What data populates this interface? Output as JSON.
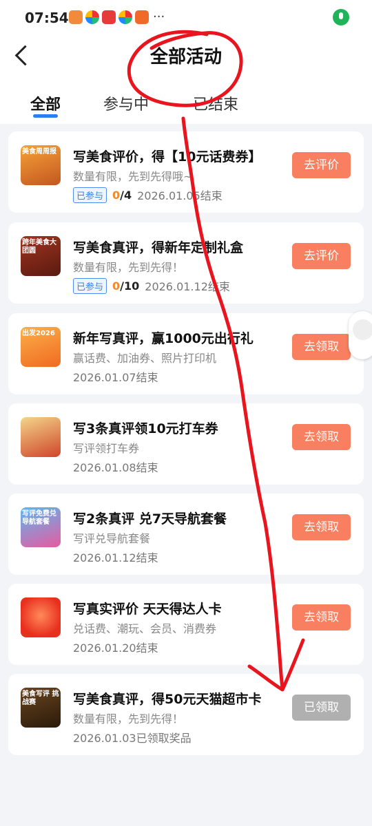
{
  "status_bar": {
    "time": "07:54",
    "dots": "···"
  },
  "header": {
    "title": "全部活动",
    "tabs": [
      {
        "label": "全部",
        "active": true
      },
      {
        "label": "参与中",
        "active": false
      },
      {
        "label": "已结束",
        "active": false
      }
    ]
  },
  "cards": [
    {
      "thumb_label": "美食周周报",
      "thumb_color": "#f7a23a",
      "title": "写美食评价，得【10元话费券】",
      "desc": "数量有限，先到先得哦~",
      "badge": "已参与",
      "progress_done": "0",
      "progress_total": "/4",
      "date": "2026.01.05结束",
      "button": "去评价"
    },
    {
      "thumb_label": "跨年美食大团圆",
      "thumb_color": "#8a2a1a",
      "title": "写美食真评，得新年定制礼盒",
      "desc": "数量有限，先到先得！",
      "badge": "已参与",
      "progress_done": "0",
      "progress_total": "/10",
      "date": "2026.01.12结束",
      "button": "去评价"
    },
    {
      "thumb_label": "出发2026",
      "thumb_color": "#f6a030",
      "title": "新年写真评，赢1000元出行礼",
      "desc": "赢话费、加油券、照片打印机",
      "date": "2026.01.07结束",
      "button": "去领取"
    },
    {
      "thumb_label": "",
      "thumb_color": "#e8c77a",
      "title": "写3条真评领10元打车券",
      "desc": "写评领打车券",
      "date": "2026.01.08结束",
      "button": "去领取"
    },
    {
      "thumb_label": "写评免费兑 导航套餐",
      "thumb_color": "#3fa0e8",
      "title": "写2条真评 兑7天导航套餐",
      "desc": "写评兑导航套餐",
      "date": "2026.01.12结束",
      "button": "去领取"
    },
    {
      "thumb_label": "",
      "thumb_color": "#f04a3a",
      "title": "写真实评价 天天得达人卡",
      "desc": "兑话费、潮玩、会员、消费券",
      "date": "2026.01.20结束",
      "button": "去领取"
    },
    {
      "thumb_label": "美食写评 挑战赛",
      "thumb_color": "#5a3a1a",
      "title": "写美食真评，得50元天猫超市卡",
      "desc": "数量有限，先到先得！",
      "date": "2026.01.03已领取奖品",
      "button": "已领取",
      "disabled": true
    }
  ],
  "colors": {
    "accent": "#2f7cf6",
    "button": "#f87f5f",
    "annotation": "#e8141e"
  }
}
